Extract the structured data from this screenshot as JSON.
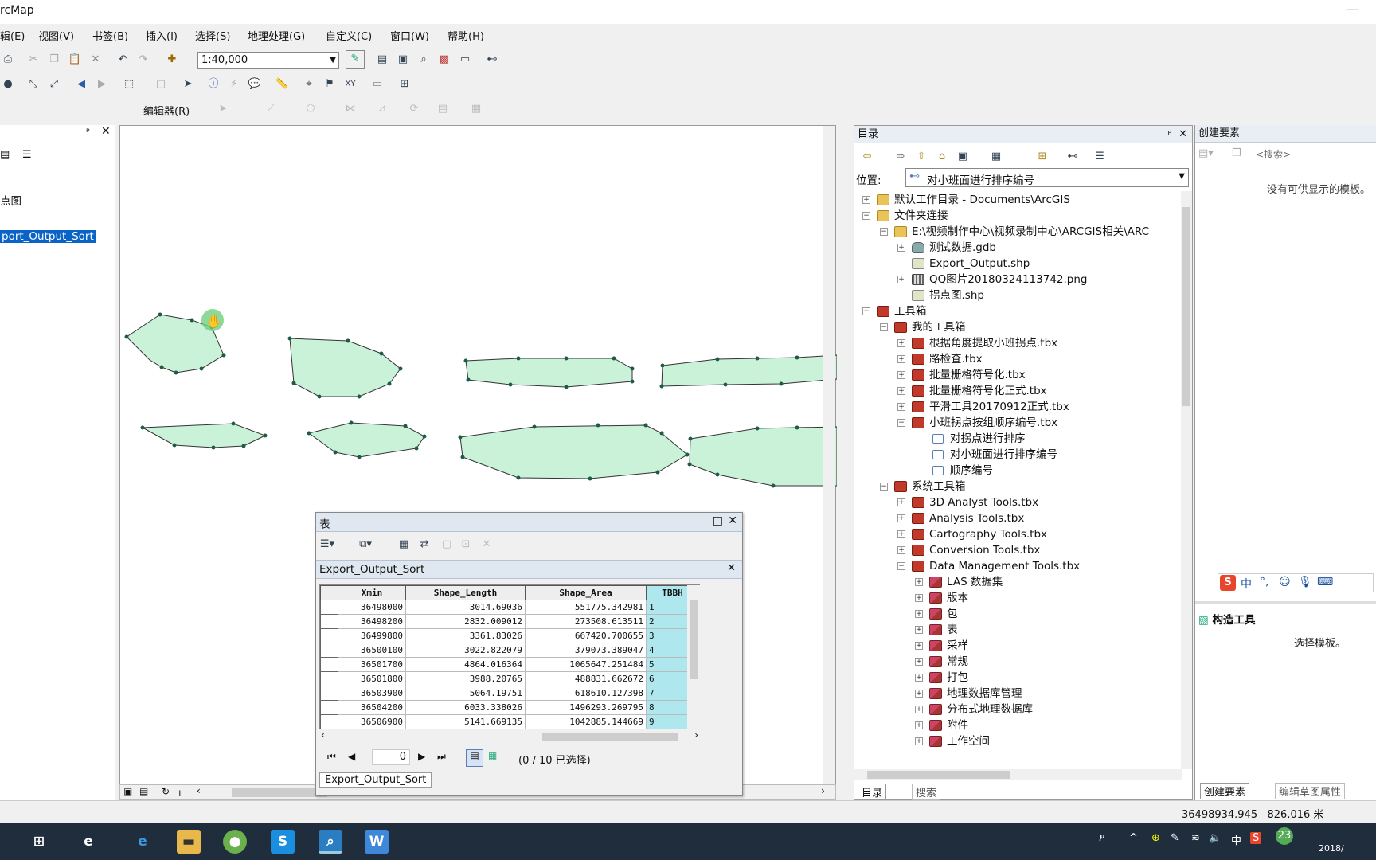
{
  "app": {
    "title": "rcMap"
  },
  "menu": [
    "辑(E)",
    "视图(V)",
    "书签(B)",
    "插入(I)",
    "选择(S)",
    "地理处理(G)",
    "自定义(C)",
    "窗口(W)",
    "帮助(H)"
  ],
  "toolbar": {
    "scale": "1:40,000",
    "editor_label": "编辑器(R)"
  },
  "left_panel": {
    "items": [
      "点图",
      "port_Output_Sort"
    ]
  },
  "catalog": {
    "title": "目录",
    "location_label": "位置:",
    "location_value": "对小班面进行排序编号",
    "tree": [
      "默认工作目录 - Documents\\ArcGIS",
      "文件夹连接",
      "E:\\视频制作中心\\视频录制中心\\ARCGIS相关\\ARC",
      "测试数据.gdb",
      "Export_Output.shp",
      "QQ图片20180324113742.png",
      "拐点图.shp",
      "工具箱",
      "我的工具箱",
      "根据角度提取小班拐点.tbx",
      "路检查.tbx",
      "批量栅格符号化.tbx",
      "批量栅格符号化正式.tbx",
      "平滑工具20170912正式.tbx",
      "小班拐点按组顺序编号.tbx",
      "对拐点进行排序",
      "对小班面进行排序编号",
      "顺序编号",
      "系统工具箱",
      "3D Analyst Tools.tbx",
      "Analysis Tools.tbx",
      "Cartography Tools.tbx",
      "Conversion Tools.tbx",
      "Data Management Tools.tbx",
      "LAS 数据集",
      "版本",
      "包",
      "表",
      "采样",
      "常规",
      "打包",
      "地理数据库管理",
      "分布式地理数据库",
      "附件",
      "工作空间"
    ],
    "tabs": [
      "目录",
      "搜索"
    ]
  },
  "create_features": {
    "title": "创建要素",
    "search_placeholder": "<搜索>",
    "empty_msg": "没有可供显示的模板。",
    "construct_title": "构造工具",
    "construct_msg": "选择模板。",
    "tabs": [
      "创建要素",
      "编辑草图属性"
    ]
  },
  "table": {
    "title": "表",
    "layer": "Export_Output_Sort",
    "columns": [
      "Xmin",
      "Shape_Length",
      "Shape_Area",
      "TBBH"
    ],
    "rows": [
      [
        "36498000",
        "3014.69036",
        "551775.342981",
        "1"
      ],
      [
        "36498200",
        "2832.009012",
        "273508.613511",
        "2"
      ],
      [
        "36499800",
        "3361.83026",
        "667420.700655",
        "3"
      ],
      [
        "36500100",
        "3022.822079",
        "379073.389047",
        "4"
      ],
      [
        "36501700",
        "4864.016364",
        "1065647.251484",
        "5"
      ],
      [
        "36501800",
        "3988.20765",
        "488831.662672",
        "6"
      ],
      [
        "36503900",
        "5064.19751",
        "618610.127398",
        "7"
      ],
      [
        "36504200",
        "6033.338026",
        "1496293.269795",
        "8"
      ],
      [
        "36506900",
        "5141.669135",
        "1042885.144669",
        "9"
      ]
    ],
    "record": "0",
    "selection": "(0 / 10 已选择)",
    "bottom_tab": "Export_Output_Sort"
  },
  "status": {
    "coords": "36498934.945   826.016 米"
  },
  "taskbar": {
    "time": "23",
    "date": "2018/"
  }
}
